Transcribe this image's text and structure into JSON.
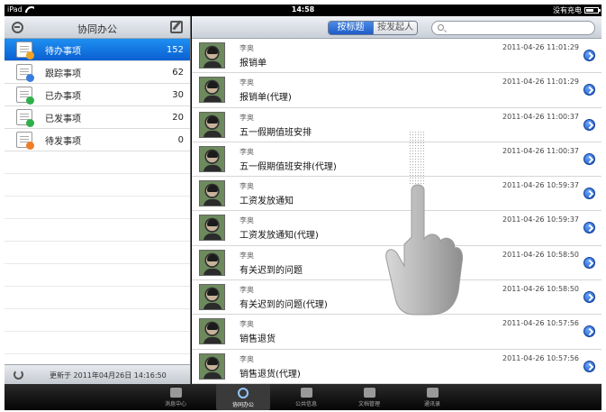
{
  "status_bar": {
    "device": "iPad",
    "time": "14:58",
    "battery_text": "没有充电"
  },
  "left": {
    "title": "协同办公",
    "items": [
      {
        "label": "待办事项",
        "count": "152",
        "active": true,
        "badge_color": "#f2a224"
      },
      {
        "label": "跟踪事项",
        "count": "62",
        "active": false,
        "badge_color": "#3a7de0"
      },
      {
        "label": "已办事项",
        "count": "30",
        "active": false,
        "badge_color": "#2fb04a"
      },
      {
        "label": "已发事项",
        "count": "20",
        "active": false,
        "badge_color": "#2fb04a"
      },
      {
        "label": "待发事项",
        "count": "0",
        "active": false,
        "badge_color": "#f07c28"
      }
    ],
    "updated_text": "更新于 2011年04月26日 14:16:50"
  },
  "right": {
    "segments": [
      {
        "label": "按标题",
        "selected": true
      },
      {
        "label": "按发起人",
        "selected": false
      }
    ],
    "search_placeholder": "",
    "messages": [
      {
        "sender": "李奥",
        "subject": "报销单",
        "time": "2011-04-26 11:01:29"
      },
      {
        "sender": "李奥",
        "subject": "报销单(代理)",
        "time": "2011-04-26 11:01:29"
      },
      {
        "sender": "李奥",
        "subject": "五一假期值班安排",
        "time": "2011-04-26 11:00:37"
      },
      {
        "sender": "李奥",
        "subject": "五一假期值班安排(代理)",
        "time": "2011-04-26 11:00:37"
      },
      {
        "sender": "李奥",
        "subject": "工资发放通知",
        "time": "2011-04-26 10:59:37"
      },
      {
        "sender": "李奥",
        "subject": "工资发放通知(代理)",
        "time": "2011-04-26 10:59:37"
      },
      {
        "sender": "李奥",
        "subject": "有关迟到的问题",
        "time": "2011-04-26 10:58:50"
      },
      {
        "sender": "李奥",
        "subject": "有关迟到的问题(代理)",
        "time": "2011-04-26 10:58:50"
      },
      {
        "sender": "李奥",
        "subject": "销售退货",
        "time": "2011-04-26 10:57:56"
      },
      {
        "sender": "李奥",
        "subject": "销售退货(代理)",
        "time": "2011-04-26 10:57:56"
      }
    ]
  },
  "tabs": [
    {
      "label": "消息中心",
      "icon": "inbox-icon",
      "active": false
    },
    {
      "label": "协同办公",
      "icon": "workflow-icon",
      "active": true
    },
    {
      "label": "公共信息",
      "icon": "info-icon",
      "active": false
    },
    {
      "label": "文档管理",
      "icon": "document-icon",
      "active": false
    },
    {
      "label": "通讯录",
      "icon": "contacts-icon",
      "active": false
    }
  ],
  "colors": {
    "selection_blue": "#0a6fe0",
    "segment_blue": "#2f6fd6",
    "tab_active_icon": "#8fc7ff"
  }
}
